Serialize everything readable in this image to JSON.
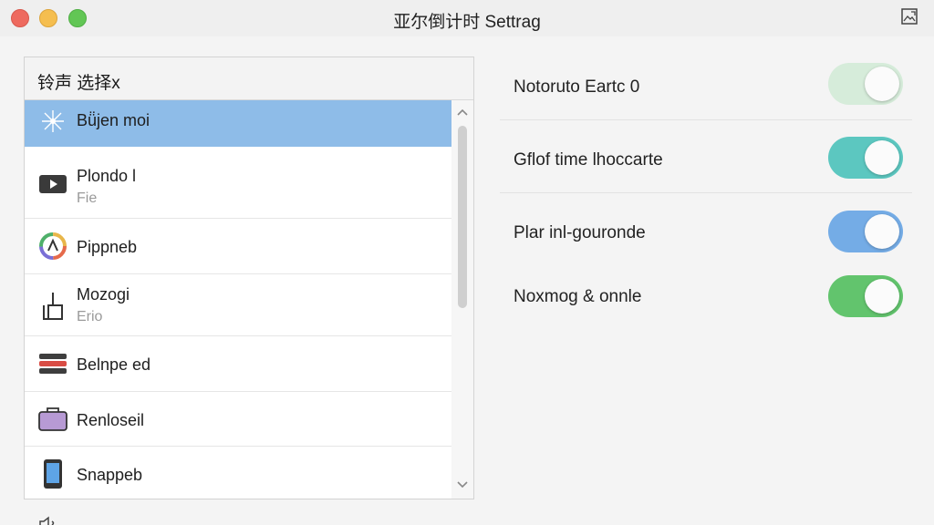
{
  "window": {
    "title": "亚尔倒计时 Settrag"
  },
  "panel": {
    "header": "铃声  选择x",
    "items": [
      {
        "name": "Bü̈jen moi",
        "sub": "",
        "icon": "sparkle-icon",
        "selected": true
      },
      {
        "name": "Plondo l",
        "sub": "Fie",
        "icon": "video-play-icon",
        "selected": false
      },
      {
        "name": "Pippneb",
        "sub": "",
        "icon": "color-wheel-icon",
        "selected": false
      },
      {
        "name": "Mozogi",
        "sub": "Erio",
        "icon": "antenna-icon",
        "selected": false
      },
      {
        "name": "Belnpe ed",
        "sub": "",
        "icon": "stack-icon",
        "selected": false
      },
      {
        "name": "Renloseil",
        "sub": "",
        "icon": "briefcase-icon",
        "selected": false
      },
      {
        "name": "Snappeb",
        "sub": "",
        "icon": "phone-icon",
        "selected": false
      }
    ]
  },
  "settings": [
    {
      "label": "Notoruto Eartc 0",
      "on": true,
      "color": "#d6ecda"
    },
    {
      "label": "Gflof time lhoccarte",
      "on": true,
      "color": "#5cc7c0"
    },
    {
      "label": "Plar inl-gouronde",
      "on": true,
      "color": "#74ace6"
    },
    {
      "label": "Noxmog & onnle",
      "on": true,
      "color": "#62c46d"
    }
  ],
  "colors": {
    "selection": "#8ebce8",
    "red": "#ee6a5f",
    "yellow": "#f5be4f",
    "green": "#62c655"
  }
}
